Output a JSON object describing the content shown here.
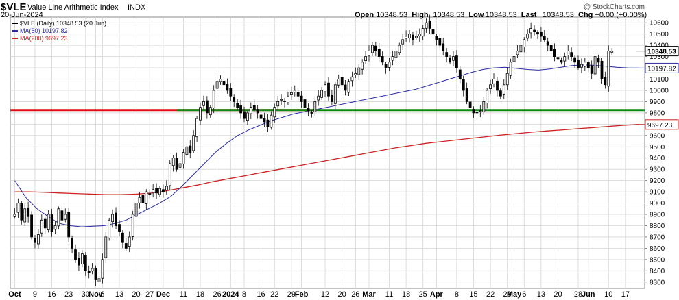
{
  "header": {
    "symbol": "$VLE",
    "name": "Value Line Arithmetic Index",
    "exchange": "INDX",
    "date": "20-Jun-2024",
    "watermark": "@ StockCharts.com",
    "ohlc": {
      "open_label": "Open",
      "open": "10348.53",
      "high_label": "High",
      "high": "10348.53",
      "low_label": "Low",
      "low": "10348.53",
      "last_label": "Last",
      "last": "10348.53",
      "chg_label": "Chg",
      "chg": "+0.00 (+0.00%)"
    }
  },
  "legend": [
    {
      "label": "$VLE (Daily) 10348.53 (20 Jun)",
      "color": "#000000"
    },
    {
      "label": "MA(50) 10197.82",
      "color": "#2a2aa0"
    },
    {
      "label": "MA(200) 9697.23",
      "color": "#cc2222"
    }
  ],
  "colors": {
    "grid": "#d4d4d4",
    "ma50": "#2a2aa0",
    "ma200": "#cc2222",
    "red_line": "#e01010",
    "green_line": "#108a10",
    "candle": "#000000"
  },
  "chart_data": {
    "type": "candlestick",
    "ylim": [
      8250,
      10650
    ],
    "y_ticks": [
      8300,
      8400,
      8500,
      8600,
      8700,
      8800,
      8900,
      9000,
      9100,
      9200,
      9300,
      9400,
      9500,
      9600,
      9700,
      9800,
      9900,
      10000,
      10100,
      10200,
      10300,
      10400,
      10500,
      10600
    ],
    "x_ticks": [
      {
        "label": "Oct",
        "bold": true,
        "idx": 0
      },
      {
        "label": "9",
        "bold": false,
        "idx": 6
      },
      {
        "label": "16",
        "bold": false,
        "idx": 11
      },
      {
        "label": "23",
        "bold": false,
        "idx": 16
      },
      {
        "label": "30",
        "bold": false,
        "idx": 21
      },
      {
        "label": "Nov",
        "bold": true,
        "idx": 24
      },
      {
        "label": "6",
        "bold": false,
        "idx": 26
      },
      {
        "label": "13",
        "bold": false,
        "idx": 31
      },
      {
        "label": "20",
        "bold": false,
        "idx": 36
      },
      {
        "label": "27",
        "bold": false,
        "idx": 40
      },
      {
        "label": "Dec",
        "bold": true,
        "idx": 44
      },
      {
        "label": "11",
        "bold": false,
        "idx": 50
      },
      {
        "label": "18",
        "bold": false,
        "idx": 55
      },
      {
        "label": "26",
        "bold": false,
        "idx": 60
      },
      {
        "label": "2024",
        "bold": true,
        "idx": 64
      },
      {
        "label": "8",
        "bold": false,
        "idx": 68
      },
      {
        "label": "16",
        "bold": false,
        "idx": 73
      },
      {
        "label": "22",
        "bold": false,
        "idx": 77
      },
      {
        "label": "29",
        "bold": false,
        "idx": 82
      },
      {
        "label": "Feb",
        "bold": true,
        "idx": 85
      },
      {
        "label": "12",
        "bold": false,
        "idx": 92
      },
      {
        "label": "20",
        "bold": false,
        "idx": 97
      },
      {
        "label": "26",
        "bold": false,
        "idx": 101
      },
      {
        "label": "Mar",
        "bold": true,
        "idx": 105
      },
      {
        "label": "11",
        "bold": false,
        "idx": 111
      },
      {
        "label": "18",
        "bold": false,
        "idx": 116
      },
      {
        "label": "25",
        "bold": false,
        "idx": 121
      },
      {
        "label": "Apr",
        "bold": true,
        "idx": 125
      },
      {
        "label": "8",
        "bold": false,
        "idx": 131
      },
      {
        "label": "15",
        "bold": false,
        "idx": 136
      },
      {
        "label": "22",
        "bold": false,
        "idx": 141
      },
      {
        "label": "29",
        "bold": false,
        "idx": 146
      },
      {
        "label": "May",
        "bold": true,
        "idx": 148
      },
      {
        "label": "6",
        "bold": false,
        "idx": 151
      },
      {
        "label": "13",
        "bold": false,
        "idx": 156
      },
      {
        "label": "20",
        "bold": false,
        "idx": 161
      },
      {
        "label": "28",
        "bold": false,
        "idx": 167
      },
      {
        "label": "Jun",
        "bold": true,
        "idx": 170
      },
      {
        "label": "10",
        "bold": false,
        "idx": 176
      },
      {
        "label": "17",
        "bold": false,
        "idx": 181
      }
    ],
    "closes": [
      8900,
      9000,
      8850,
      8950,
      8880,
      8700,
      8650,
      8720,
      8850,
      8780,
      8900,
      8750,
      8800,
      8950,
      8850,
      8900,
      8700,
      8600,
      8500,
      8450,
      8550,
      8400,
      8380,
      8420,
      8320,
      8330,
      8500,
      8700,
      8850,
      8900,
      8800,
      8750,
      8650,
      8600,
      8700,
      8900,
      9000,
      9050,
      9000,
      9100,
      9080,
      9120,
      9090,
      9130,
      9100,
      9150,
      9350,
      9400,
      9300,
      9350,
      9450,
      9500,
      9450,
      9600,
      9750,
      9850,
      9900,
      9800,
      9850,
      10000,
      10080,
      10100,
      10050,
      10000,
      9950,
      9900,
      9850,
      9800,
      9750,
      9800,
      9850,
      9830,
      9800,
      9750,
      9720,
      9680,
      9780,
      9850,
      9900,
      9920,
      9900,
      9950,
      9980,
      10000,
      9950,
      9900,
      9850,
      9820,
      9800,
      9900,
      9950,
      10000,
      10050,
      9950,
      9900,
      10050,
      10100,
      10050,
      10000,
      10080,
      10120,
      10150,
      10200,
      10250,
      10300,
      10350,
      10400,
      10350,
      10300,
      10250,
      10200,
      10250,
      10300,
      10350,
      10400,
      10450,
      10480,
      10500,
      10450,
      10480,
      10500,
      10550,
      10600,
      10550,
      10500,
      10450,
      10400,
      10350,
      10300,
      10250,
      10300,
      10200,
      10100,
      10000,
      9900,
      9850,
      9800,
      9800,
      9820,
      9900,
      10000,
      10050,
      10100,
      10000,
      9950,
      10050,
      10150,
      10250,
      10300,
      10350,
      10400,
      10450,
      10500,
      10550,
      10520,
      10500,
      10480,
      10450,
      10400,
      10350,
      10300,
      10280,
      10250,
      10300,
      10350,
      10300,
      10250,
      10200,
      10230,
      10250,
      10200,
      10150,
      10300,
      10250,
      10100,
      10050,
      10350,
      10348.53
    ],
    "ma50": [
      9200,
      9050,
      8950,
      8880,
      8820,
      8800,
      8790,
      8795,
      8800,
      8820,
      8850,
      8900,
      8950,
      9000,
      9060,
      9150,
      9250,
      9350,
      9450,
      9530,
      9600,
      9650,
      9690,
      9730,
      9760,
      9790,
      9810,
      9830,
      9850,
      9870,
      9890,
      9910,
      9930,
      9950,
      9970,
      9990,
      10010,
      10040,
      10070,
      10100,
      10130,
      10160,
      10185,
      10200,
      10205,
      10195,
      10185,
      10180,
      10190,
      10205,
      10220,
      10225,
      10222,
      10215,
      10205,
      10200,
      10197.82
    ],
    "ma200": [
      9100,
      9100,
      9095,
      9090,
      9085,
      9080,
      9075,
      9075,
      9080,
      9090,
      9110,
      9135,
      9160,
      9190,
      9215,
      9240,
      9265,
      9290,
      9315,
      9340,
      9365,
      9390,
      9415,
      9440,
      9465,
      9490,
      9510,
      9530,
      9545,
      9560,
      9575,
      9590,
      9605,
      9617,
      9630,
      9640,
      9650,
      9660,
      9670,
      9680,
      9690,
      9697.23
    ],
    "ma50_label": "10197.82",
    "ma200_label": "9697.23",
    "last_label": "10348.53",
    "red_level": 9825,
    "green_level": 9825,
    "n_bars": 186
  }
}
